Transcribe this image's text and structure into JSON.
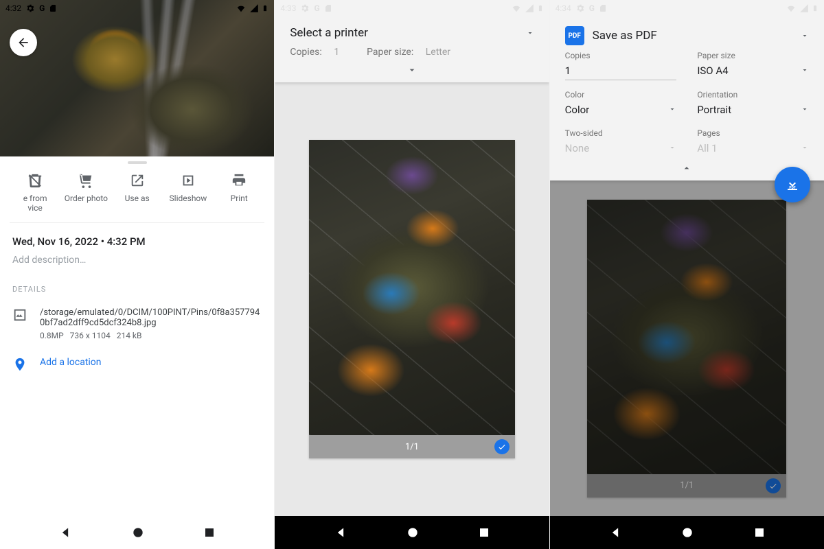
{
  "phone1": {
    "status_time": "4:32",
    "back_icon": "arrow-back",
    "actions": [
      {
        "icon": "delete",
        "label": "e from\nvice"
      },
      {
        "icon": "cart",
        "label": "Order photo"
      },
      {
        "icon": "open-in",
        "label": "Use as"
      },
      {
        "icon": "slideshow",
        "label": "Slideshow"
      },
      {
        "icon": "print",
        "label": "Print"
      }
    ],
    "datetime": "Wed, Nov 16, 2022 • 4:32 PM",
    "add_description": "Add description…",
    "details_label": "DETAILS",
    "file_path": "/storage/emulated/0/DCIM/100PINT/Pins/0f8a3577940bf7ad2dff9cd5dcf324b8.jpg",
    "file_mp": "0.8MP",
    "file_dims": "736 x 1104",
    "file_size": "214 kB",
    "add_location": "Add a location"
  },
  "phone2": {
    "status_time": "4:33",
    "printer_title": "Select a printer",
    "copies_label": "Copies:",
    "copies_value": "1",
    "papersize_label": "Paper size:",
    "papersize_value": "Letter",
    "page_counter": "1/1"
  },
  "phone3": {
    "status_time": "4:34",
    "printer_title": "Save as PDF",
    "fields": {
      "copies": {
        "label": "Copies",
        "value": "1"
      },
      "paper_size": {
        "label": "Paper size",
        "value": "ISO A4"
      },
      "color": {
        "label": "Color",
        "value": "Color"
      },
      "orientation": {
        "label": "Orientation",
        "value": "Portrait"
      },
      "two_sided": {
        "label": "Two-sided",
        "value": "None"
      },
      "pages": {
        "label": "Pages",
        "value": "All 1"
      }
    },
    "page_counter": "1/1"
  }
}
